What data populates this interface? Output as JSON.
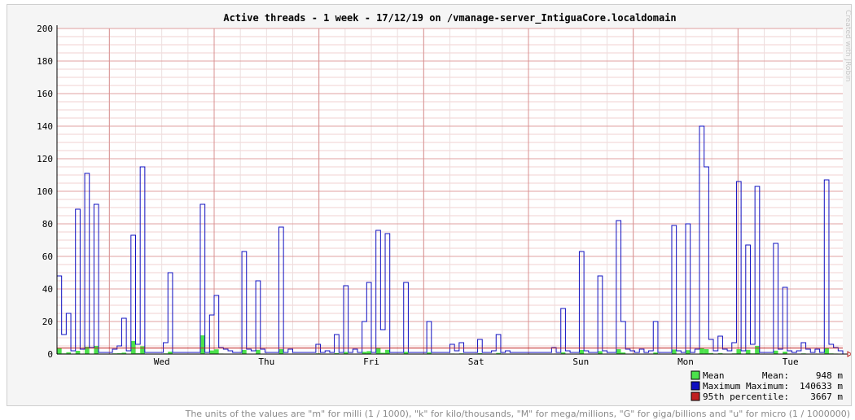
{
  "chart_data": {
    "type": "bar",
    "title": "Active threads - 1 week - 17/12/19 on /vmanage-server_IntiguaCore.localdomain",
    "xlabel": "",
    "ylabel": "",
    "ylim": [
      0,
      200
    ],
    "yticks": [
      0,
      20,
      40,
      60,
      80,
      100,
      120,
      140,
      160,
      180,
      200
    ],
    "day_labels": [
      "Wed",
      "Thu",
      "Fri",
      "Sat",
      "Sun",
      "Mon",
      "Tue"
    ],
    "grid": true,
    "legend_position": "bottom-right",
    "units_note": "The units of the values are \"m\" for milli (1 / 1000), \"k\" for kilo/thousands, \"M\" for mega/millions, \"G\" for giga/billions and \"u\" for micro (1 / 1000000)",
    "credit": "Created with JRobin",
    "series": [
      {
        "name": "Maximum",
        "values": [
          48,
          12,
          25,
          2,
          89,
          3,
          111,
          4,
          92,
          1,
          1,
          1,
          3,
          5,
          22,
          2,
          73,
          6,
          115,
          1,
          1,
          1,
          1,
          7,
          50,
          1,
          1,
          1,
          1,
          1,
          1,
          92,
          1,
          24,
          36,
          4,
          3,
          2,
          1,
          1,
          63,
          3,
          2,
          45,
          3,
          1,
          1,
          1,
          78,
          1,
          3,
          1,
          1,
          1,
          1,
          1,
          6,
          1,
          2,
          1,
          12,
          1,
          42,
          1,
          3,
          1,
          20,
          44,
          1,
          76,
          15,
          74,
          1,
          1,
          1,
          44,
          1,
          1,
          1,
          1,
          20,
          1,
          1,
          1,
          1,
          6,
          2,
          7,
          1,
          1,
          1,
          9,
          1,
          1,
          2,
          12,
          1,
          2,
          1,
          1,
          1,
          1,
          1,
          1,
          1,
          1,
          1,
          4,
          1,
          28,
          2,
          1,
          1,
          63,
          2,
          1,
          1,
          48,
          2,
          1,
          1,
          82,
          20,
          3,
          2,
          1,
          3,
          1,
          2,
          20,
          1,
          1,
          1,
          79,
          2,
          1,
          80,
          1,
          3,
          140,
          115,
          9,
          2,
          11,
          3,
          2,
          7,
          106,
          2,
          67,
          6,
          103,
          1,
          1,
          1,
          68,
          3,
          41,
          2,
          1,
          2,
          7,
          3,
          1,
          3,
          1,
          107,
          6,
          4,
          2
        ]
      },
      {
        "name": "Mean",
        "values": [
          3.5,
          0.4,
          1.1,
          0.1,
          2.0,
          0.1,
          4.5,
          0.1,
          5.0,
          0.1,
          0.1,
          0.2,
          0.4,
          0.5,
          0.9,
          0.2,
          8.0,
          0.5,
          4.8,
          0.1,
          0.1,
          0.1,
          0.1,
          0.4,
          1.5,
          0.1,
          0.1,
          0.1,
          0.1,
          0.1,
          0.1,
          11.5,
          0.1,
          2.2,
          2.9,
          0.3,
          0.2,
          0.1,
          0.1,
          0.1,
          2.5,
          0.2,
          0.1,
          2.6,
          0.2,
          0.1,
          0.1,
          0.1,
          3.0,
          0.1,
          0.2,
          0.1,
          0.1,
          0.1,
          0.1,
          0.1,
          0.4,
          0.1,
          0.1,
          0.1,
          0.6,
          0.1,
          1.3,
          0.1,
          0.2,
          0.1,
          1.4,
          1.8,
          0.1,
          4.0,
          0.8,
          2.6,
          0.1,
          0.1,
          0.1,
          1.4,
          0.1,
          0.1,
          0.1,
          0.1,
          1.1,
          0.1,
          0.1,
          0.1,
          0.1,
          0.3,
          0.1,
          0.4,
          0.1,
          0.1,
          0.1,
          0.5,
          0.1,
          0.1,
          0.1,
          0.7,
          0.1,
          0.1,
          0.1,
          0.1,
          0.1,
          0.1,
          0.1,
          0.1,
          0.1,
          0.1,
          0.1,
          0.2,
          0.1,
          1.1,
          0.1,
          0.1,
          0.1,
          2.5,
          0.1,
          0.1,
          0.1,
          1.8,
          0.1,
          0.1,
          0.1,
          3.0,
          1.0,
          0.2,
          0.1,
          0.1,
          0.2,
          0.1,
          0.1,
          1.0,
          0.1,
          0.1,
          0.1,
          2.8,
          0.1,
          0.1,
          2.4,
          0.1,
          0.2,
          3.5,
          3.0,
          0.6,
          0.1,
          0.6,
          0.2,
          0.1,
          0.4,
          3.0,
          0.1,
          2.6,
          0.4,
          5.0,
          0.1,
          0.1,
          0.1,
          2.1,
          0.2,
          1.5,
          0.1,
          0.1,
          0.1,
          0.4,
          0.2,
          0.1,
          0.2,
          0.1,
          3.8,
          0.4,
          0.3,
          0.1
        ]
      }
    ],
    "percentile_95": 3.667,
    "legend": [
      {
        "key": "mean",
        "name": "Mean",
        "stat_label": "Mean:",
        "stat_value": "948 m",
        "color": "#4be24b"
      },
      {
        "key": "max",
        "name": "Maximum",
        "stat_label": "Maximum:",
        "stat_value": "140633 m",
        "color": "#1010c0"
      },
      {
        "key": "p95",
        "name": "95th percentile",
        "stat_label": ":",
        "stat_value": "3667 m",
        "color": "#c02020"
      }
    ]
  }
}
